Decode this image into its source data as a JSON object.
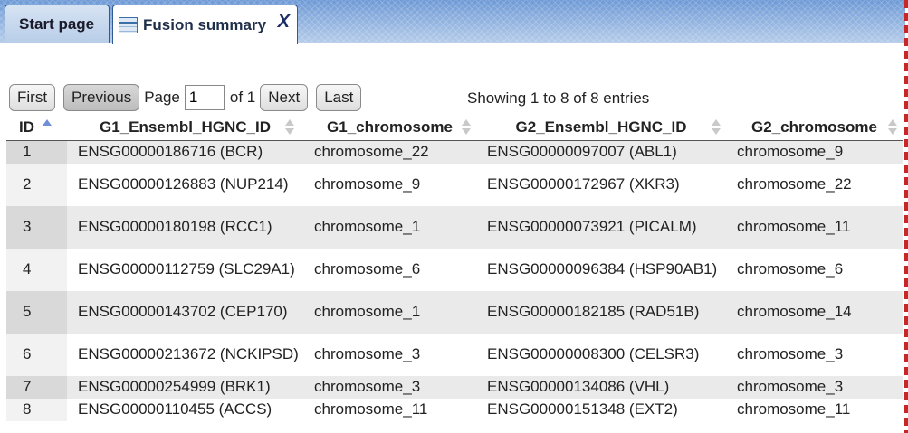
{
  "tabs": [
    {
      "label": "Start page"
    },
    {
      "label": "Fusion summary",
      "close": "X"
    }
  ],
  "pager": {
    "first": "First",
    "previous": "Previous",
    "page_label": "Page",
    "page_value": "1",
    "of_label": "of 1",
    "next": "Next",
    "last": "Last",
    "showing": "Showing 1 to 8 of 8 entries"
  },
  "table": {
    "columns": [
      "ID",
      "G1_Ensembl_HGNC_ID",
      "G1_chromosome",
      "G2_Ensembl_HGNC_ID",
      "G2_chromosome"
    ],
    "sort_column": "ID",
    "sort_direction": "ascending",
    "rows": [
      {
        "id": "1",
        "g1_id": "ENSG00000186716 (BCR)",
        "g1_chr": "chromosome_22",
        "g2_id": "ENSG00000097007 (ABL1)",
        "g2_chr": "chromosome_9"
      },
      {
        "id": "2",
        "g1_id": "ENSG00000126883 (NUP214)",
        "g1_chr": "chromosome_9",
        "g2_id": "ENSG00000172967 (XKR3)",
        "g2_chr": "chromosome_22"
      },
      {
        "id": "3",
        "g1_id": "ENSG00000180198 (RCC1)",
        "g1_chr": "chromosome_1",
        "g2_id": "ENSG00000073921 (PICALM)",
        "g2_chr": "chromosome_11"
      },
      {
        "id": "4",
        "g1_id": "ENSG00000112759 (SLC29A1)",
        "g1_chr": "chromosome_6",
        "g2_id": "ENSG00000096384 (HSP90AB1)",
        "g2_chr": "chromosome_6"
      },
      {
        "id": "5",
        "g1_id": "ENSG00000143702 (CEP170)",
        "g1_chr": "chromosome_1",
        "g2_id": "ENSG00000182185 (RAD51B)",
        "g2_chr": "chromosome_14"
      },
      {
        "id": "6",
        "g1_id": "ENSG00000213672 (NCKIPSD)",
        "g1_chr": "chromosome_3",
        "g2_id": "ENSG00000008300 (CELSR3)",
        "g2_chr": "chromosome_3"
      },
      {
        "id": "7",
        "g1_id": "ENSG00000254999 (BRK1)",
        "g1_chr": "chromosome_3",
        "g2_id": "ENSG00000134086 (VHL)",
        "g2_chr": "chromosome_3"
      },
      {
        "id": "8",
        "g1_id": "ENSG00000110455 (ACCS)",
        "g1_chr": "chromosome_11",
        "g2_id": "ENSG00000151348 (EXT2)",
        "g2_chr": "chromosome_11"
      }
    ]
  },
  "colors": {
    "tabbar": "#6f9ad6",
    "row_odd": "#eaeaea",
    "sort_active": "#6f8fd8",
    "edge_dash": "#c62828"
  },
  "icons": {
    "fusion_tab": "table-icon",
    "sort": "sort-arrows-icon"
  }
}
